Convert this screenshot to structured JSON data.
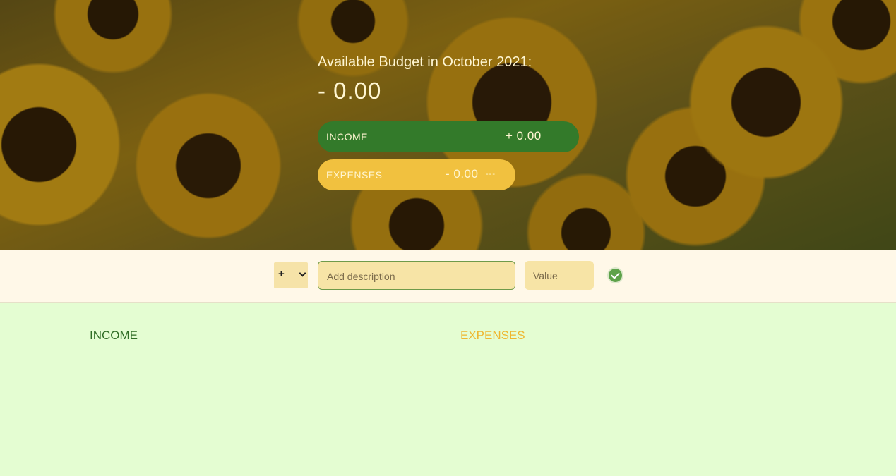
{
  "header": {
    "title": "Available Budget in October 2021:",
    "budget_value": "- 0.00",
    "income": {
      "label": "INCOME",
      "value": "+ 0.00",
      "color": "#337a2a"
    },
    "expenses": {
      "label": "EXPENSES",
      "value": "- 0.00",
      "percentage": "---",
      "color": "#f1c13f"
    }
  },
  "add_bar": {
    "type_select": {
      "selected": "+"
    },
    "description_placeholder": "Add description",
    "value_placeholder": "Value",
    "confirm_icon": "check-circle-icon"
  },
  "lists": {
    "income_title": "INCOME",
    "expenses_title": "EXPENSES",
    "income_color": "#2f6d25",
    "expenses_color": "#efb62f"
  }
}
